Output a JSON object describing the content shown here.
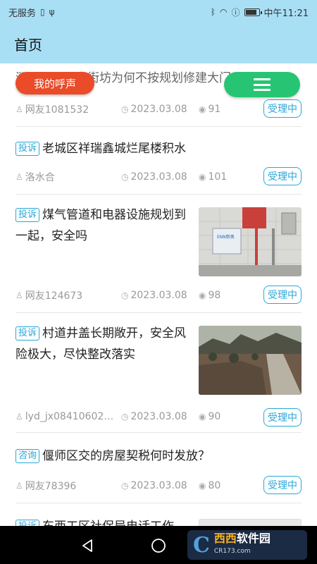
{
  "status_bar": {
    "carrier": "无服务",
    "time": "中午11:21",
    "battery_level": 0.85
  },
  "header": {
    "title": "首页"
  },
  "fab": {
    "voice_label": "我的呼声",
    "menu_icon": "hamburger-icon"
  },
  "items": [
    {
      "tag": "",
      "title": "涧西区一号南街坊为何不按规划修建大门",
      "author": "网友1081532",
      "date": "2023.03.08",
      "views": "91",
      "status": "受理中"
    },
    {
      "tag": "投诉",
      "title": "老城区祥瑞鑫城烂尾楼积水",
      "author": "洛水合",
      "date": "2023.03.08",
      "views": "101",
      "status": "受理中"
    },
    {
      "tag": "投诉",
      "title": "煤气管道和电器设施规划到一起，安全吗",
      "author": "网友124673",
      "date": "2023.03.08",
      "views": "98",
      "status": "受理中",
      "image_label": "ENN新奥"
    },
    {
      "tag": "投诉",
      "title": "村道井盖长期敞开，安全风险极大，尽快整改落实",
      "author": "lyd_jx08410602…",
      "date": "2023.03.08",
      "views": "90",
      "status": "受理中"
    },
    {
      "tag": "咨询",
      "title": "偃师区交的房屋契税何时发放？",
      "author": "网友78396",
      "date": "2023.03.08",
      "views": "80",
      "status": "受理中"
    },
    {
      "tag": "投诉",
      "title": "东西工区社保局电话工作"
    }
  ],
  "watermark": {
    "main": "西西",
    "sub": "软件园",
    "url": "CR173.com"
  },
  "colors": {
    "header_bg": "#a9dff5",
    "accent": "#2aa7d8",
    "voice_btn": "#ea4b28",
    "menu_btn": "#27c573"
  }
}
